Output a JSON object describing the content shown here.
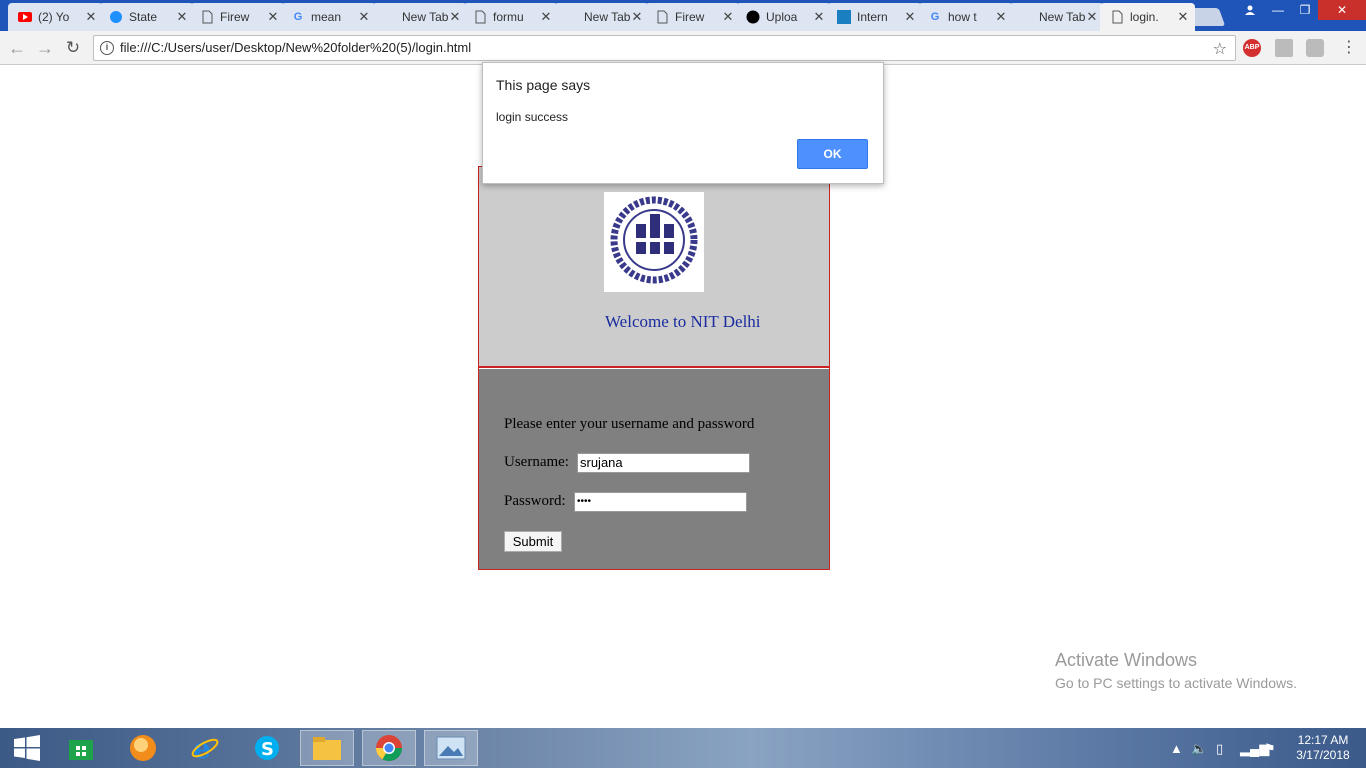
{
  "browser": {
    "tabs": [
      {
        "label": "(2) Yo",
        "icon": "youtube-icon",
        "color": "#ff0000"
      },
      {
        "label": "State",
        "icon": "globe-icon",
        "color": "#1e90ff"
      },
      {
        "label": "Firew",
        "icon": "page-icon",
        "color": "#555555"
      },
      {
        "label": "mean",
        "icon": "google-icon",
        "color": "#4285f4"
      },
      {
        "label": "New Tab",
        "icon": "",
        "color": ""
      },
      {
        "label": "formu",
        "icon": "page-icon",
        "color": "#555555"
      },
      {
        "label": "New Tab",
        "icon": "",
        "color": ""
      },
      {
        "label": "Firew",
        "icon": "page-icon",
        "color": "#555555"
      },
      {
        "label": "Uploa",
        "icon": "github-icon",
        "color": "#000000"
      },
      {
        "label": "Intern",
        "icon": "internshala-icon",
        "color": "#1a7fc1"
      },
      {
        "label": "how t",
        "icon": "google-icon",
        "color": "#4285f4"
      },
      {
        "label": "New Tab",
        "icon": "",
        "color": ""
      },
      {
        "label": "login.",
        "icon": "page-icon",
        "color": "#555555",
        "active": true
      }
    ],
    "url": "file:///C:/Users/user/Desktop/New%20folder%20(5)/login.html",
    "extensions": {
      "abp": "ABP"
    }
  },
  "dialog": {
    "title": "This page says",
    "message": "login success",
    "ok_label": "OK"
  },
  "page": {
    "welcome": "Welcome to NIT Delhi",
    "instruction": "Please enter your username and password",
    "username_label": "Username:",
    "username_value": "srujana",
    "password_label": "Password:",
    "password_value": "••••",
    "submit_label": "Submit"
  },
  "watermark": {
    "title": "Activate Windows",
    "subtitle": "Go to PC settings to activate Windows."
  },
  "taskbar": {
    "time": "12:17 AM",
    "date": "3/17/2018"
  },
  "colors": {
    "accent_red": "#cc2222",
    "welcome_blue": "#1a2c9e",
    "ok_blue": "#4d90fe"
  }
}
